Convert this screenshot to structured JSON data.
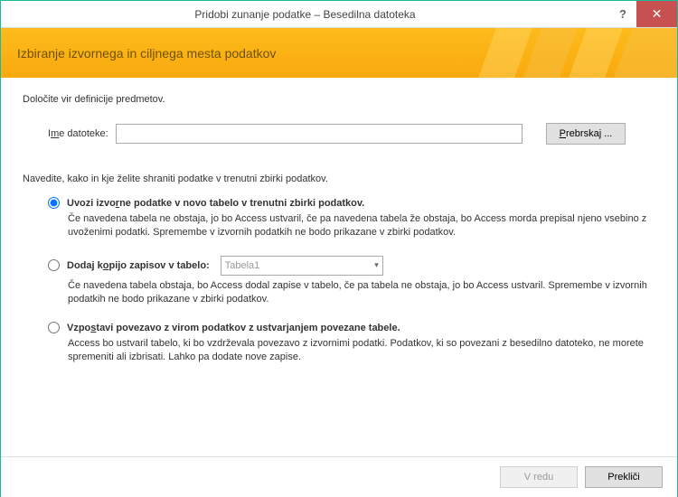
{
  "titlebar": {
    "title": "Pridobi zunanje podatke – Besedilna datoteka",
    "help": "?",
    "close": "✕"
  },
  "banner": {
    "heading": "Izbiranje izvornega in ciljnega mesta podatkov"
  },
  "content": {
    "prompt": "Določite vir definicije predmetov.",
    "file_label_pre": "I",
    "file_label_u": "m",
    "file_label_post": "e datoteke:",
    "file_value": "",
    "browse_pre": "",
    "browse_u": "P",
    "browse_post": "rebrskaj ...",
    "instr": "Navedite, kako in kje želite shraniti podatke v trenutni zbirki podatkov.",
    "options": [
      {
        "pre": "Uvozi izvo",
        "u": "r",
        "post": "ne podatke v novo tabelo v trenutni zbirki podatkov.",
        "desc": "Če navedena tabela ne obstaja, jo bo Access ustvaril, če pa navedena tabela že obstaja, bo Access morda prepisal njeno vsebino z uvoženimi podatki. Spremembe v izvornih podatkih ne bodo prikazane v zbirki podatkov.",
        "checked": true
      },
      {
        "pre": "Dodaj k",
        "u": "o",
        "post": "pijo zapisov v tabelo:",
        "desc": "Če navedena tabela obstaja, bo Access dodal zapise v tabelo, če pa tabela ne obstaja, jo bo Access ustvaril. Spremembe v izvornih podatkih ne bodo prikazane v zbirki podatkov.",
        "checked": false,
        "select_value": "Tabela1"
      },
      {
        "pre": "Vzpo",
        "u": "s",
        "post": "tavi povezavo z virom podatkov z ustvarjanjem povezane tabele.",
        "desc": "Access bo ustvaril tabelo, ki bo vzdrževala povezavo z izvornimi podatki. Podatkov, ki so povezani z besedilno datoteko, ne morete spremeniti ali izbrisati. Lahko pa dodate nove zapise.",
        "checked": false
      }
    ]
  },
  "footer": {
    "ok": "V redu",
    "cancel": "Prekliči"
  }
}
